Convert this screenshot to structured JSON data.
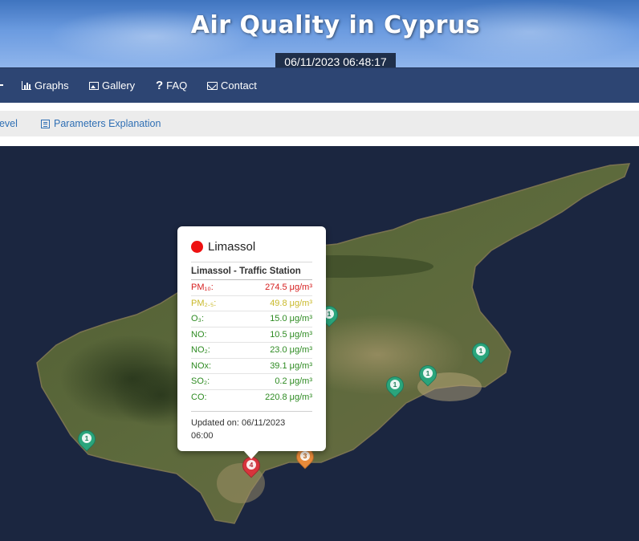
{
  "header": {
    "title": "Air Quality in Cyprus",
    "datetime": "06/11/2023 06:48:17"
  },
  "nav": {
    "items": [
      {
        "label": "Graphs",
        "icon": "bar-chart-icon"
      },
      {
        "label": "Gallery",
        "icon": "image-icon"
      },
      {
        "label": "FAQ",
        "icon": "question-icon"
      },
      {
        "label": "Contact",
        "icon": "envelope-icon"
      }
    ]
  },
  "subnav": {
    "items": [
      {
        "label": "Level"
      },
      {
        "label": "Parameters Explanation",
        "icon": "list-icon"
      }
    ]
  },
  "map": {
    "markers": [
      {
        "label": "1",
        "status": "green"
      },
      {
        "label": "1",
        "status": "green"
      },
      {
        "label": "1",
        "status": "green"
      },
      {
        "label": "1",
        "status": "green"
      },
      {
        "label": "1",
        "status": "green"
      },
      {
        "label": "4",
        "status": "red"
      },
      {
        "label": "3",
        "status": "orange"
      }
    ],
    "colors": {
      "green": "#2aa57c",
      "red": "#d8343c",
      "orange": "#e88a3a",
      "sea": "#1b2640"
    }
  },
  "popup": {
    "city": "Limassol",
    "status_color": "#ee1111",
    "station": "Limassol - Traffic Station",
    "readings": [
      {
        "param": "PM₁₀:",
        "value": "274.5 μg/m³",
        "color": "#d62020"
      },
      {
        "param": "PM₂.₅:",
        "value": "49.8 μg/m³",
        "color": "#c9b92a"
      },
      {
        "param": "O₃:",
        "value": "15.0 μg/m³",
        "color": "#2e8b22"
      },
      {
        "param": "NO:",
        "value": "10.5 μg/m³",
        "color": "#2e8b22"
      },
      {
        "param": "NO₂:",
        "value": "23.0 μg/m³",
        "color": "#2e8b22"
      },
      {
        "param": "NOx:",
        "value": "39.1 μg/m³",
        "color": "#2e8b22"
      },
      {
        "param": "SO₂:",
        "value": "0.2 μg/m³",
        "color": "#2e8b22"
      },
      {
        "param": "CO:",
        "value": "220.8 μg/m³",
        "color": "#2e8b22"
      }
    ],
    "updated_label": "Updated on: 06/11/2023",
    "updated_time": "06:00"
  }
}
